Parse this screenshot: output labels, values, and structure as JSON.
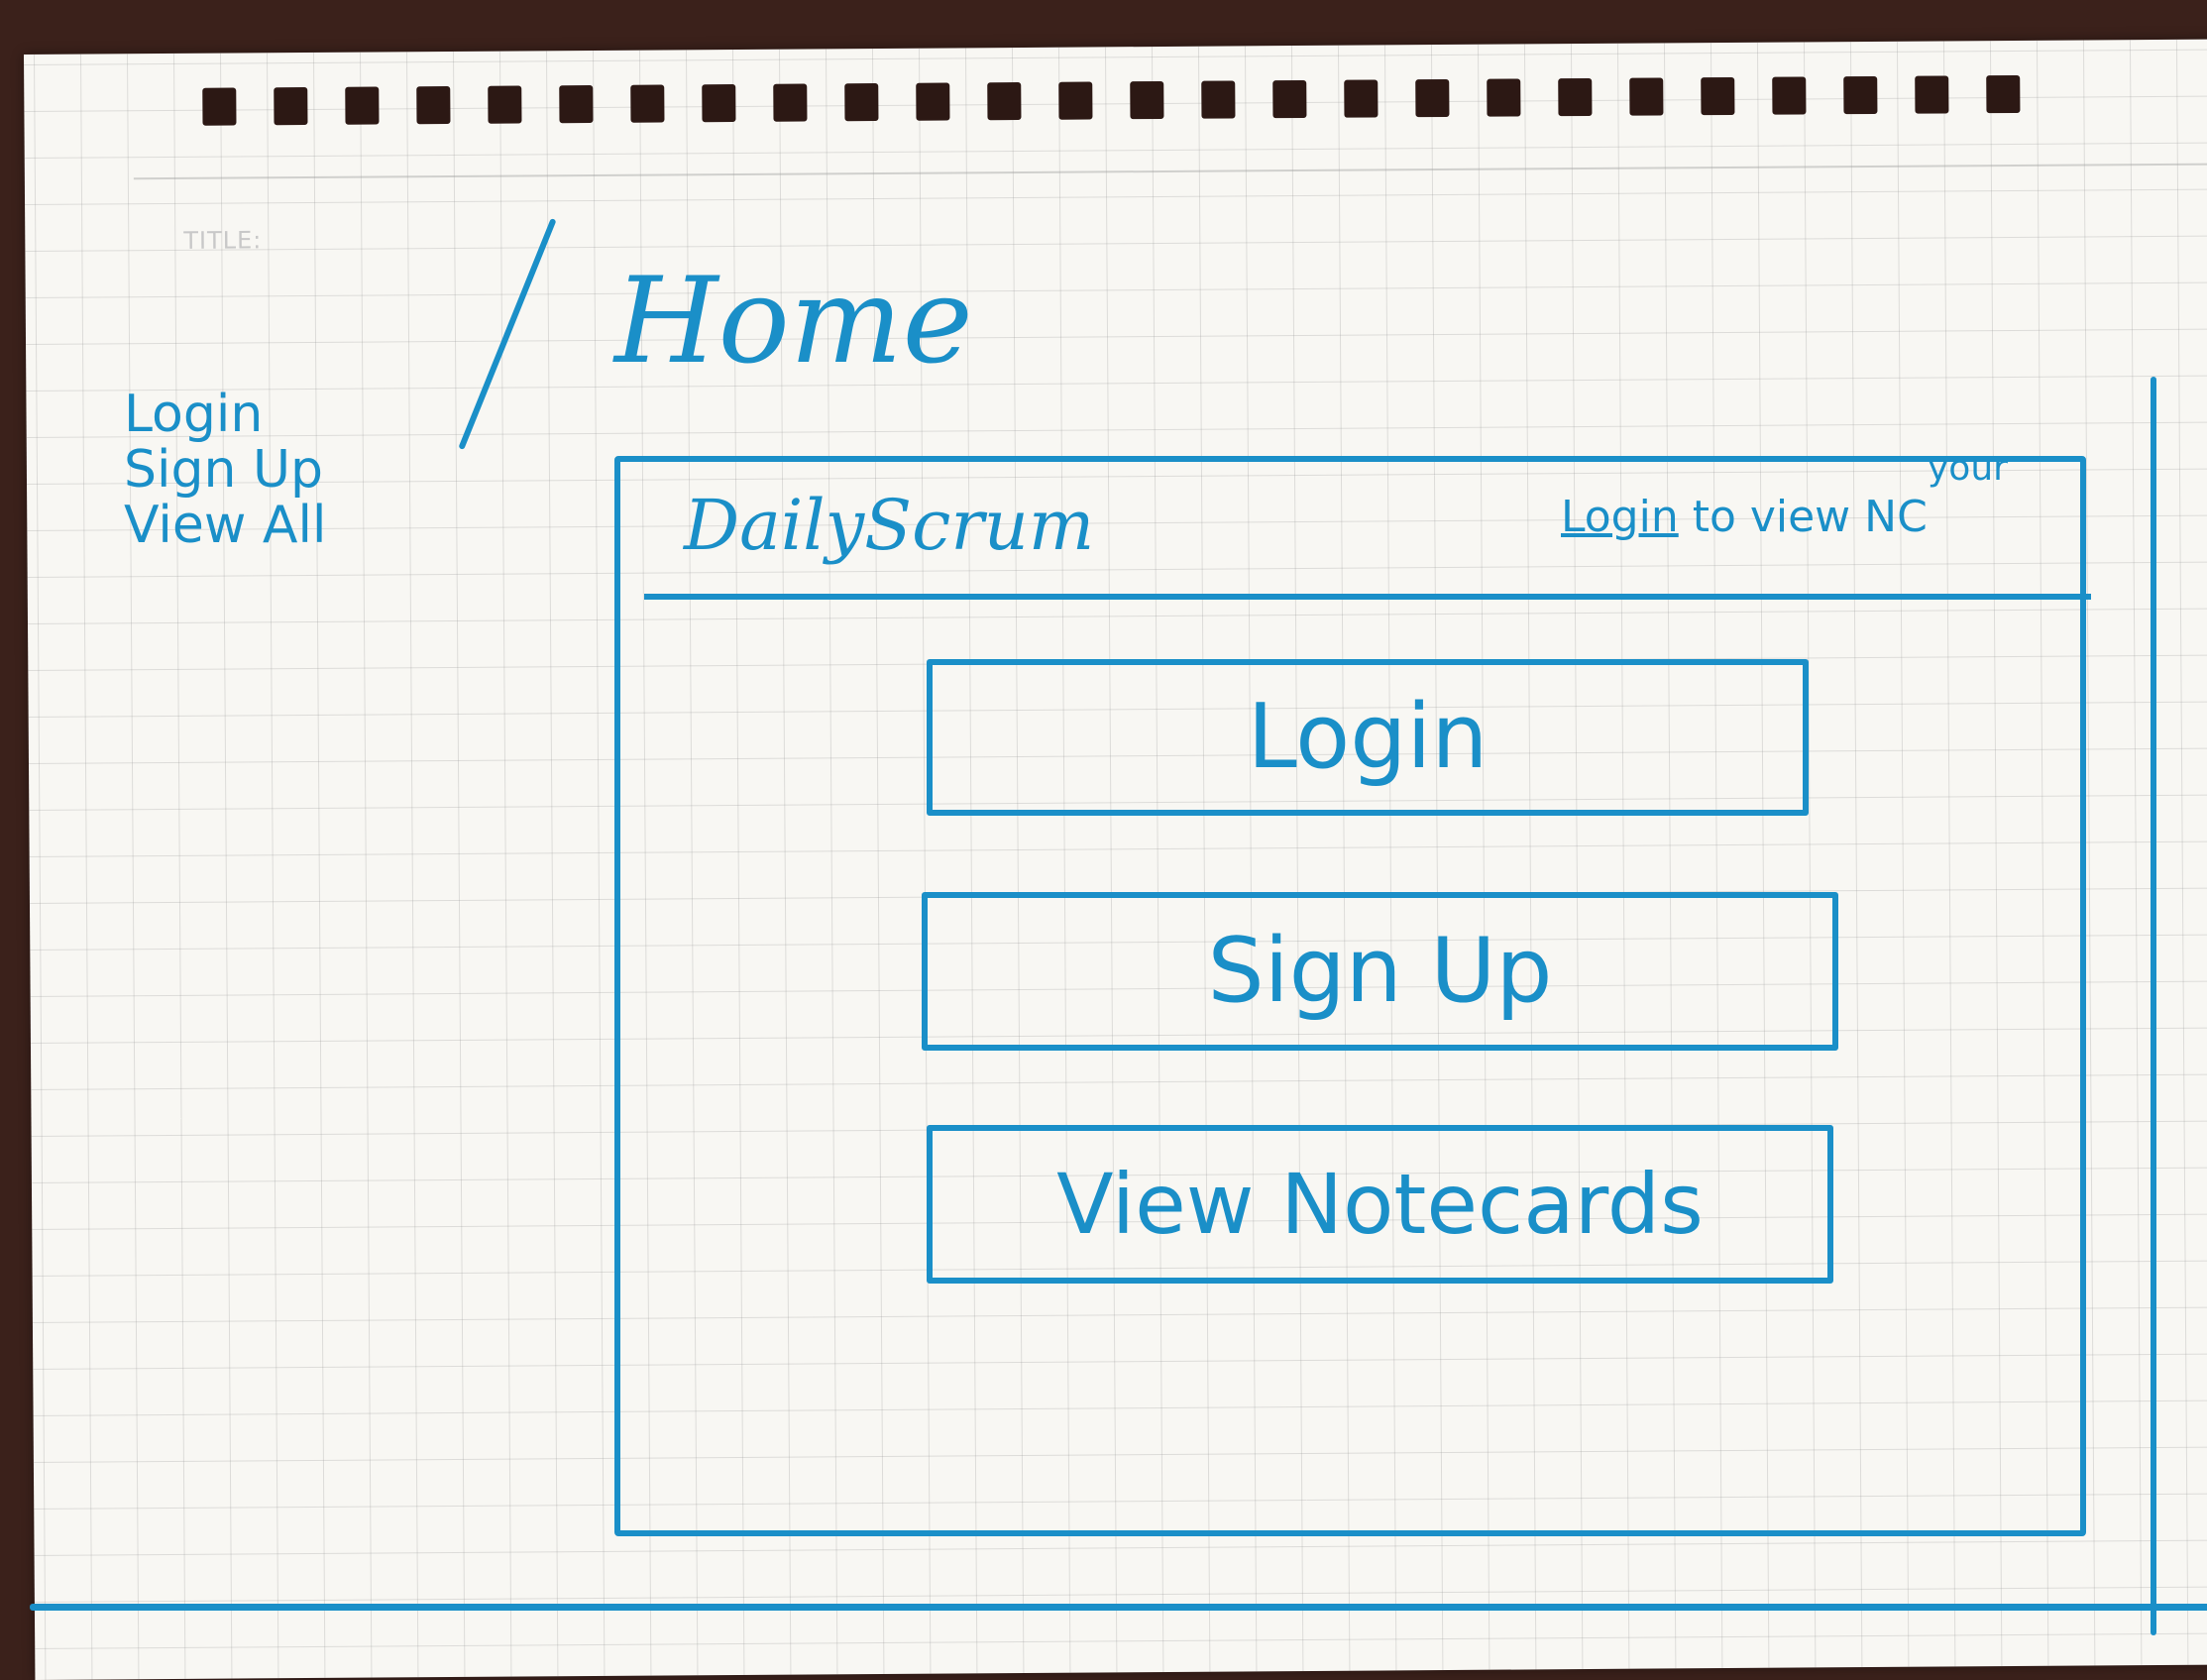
{
  "sheet": {
    "title_field_label": "TITLE:"
  },
  "page": {
    "heading": "Home"
  },
  "sitemap": {
    "items": [
      "Login",
      "Sign Up",
      "View All"
    ]
  },
  "navbar": {
    "brand": "DailyScrum",
    "login_link": "Login",
    "message_suffix": " to view NC",
    "message_insert": "your"
  },
  "buttons": {
    "login": "Login",
    "signup": "Sign Up",
    "view_notecards": "View Notecards"
  },
  "colors": {
    "ink": "#1a8fc8",
    "paper": "#f8f7f3",
    "grid": "#969696",
    "table": "#3b211b"
  }
}
